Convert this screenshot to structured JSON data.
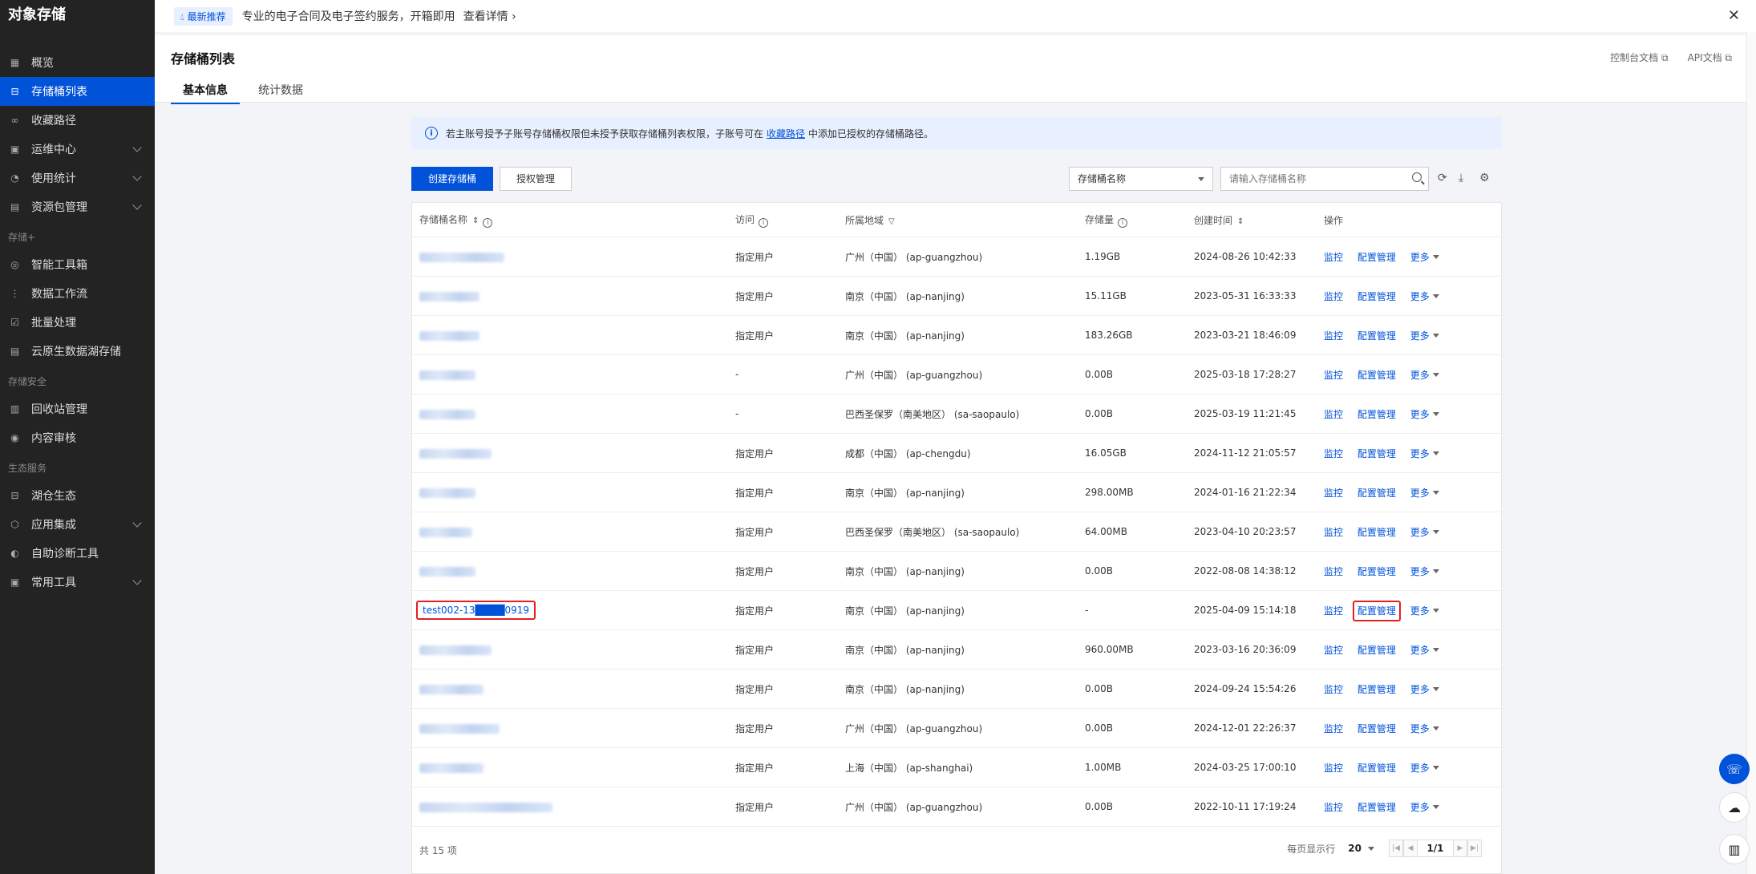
{
  "app": {
    "title": "对象存储"
  },
  "sidebar": {
    "items": [
      {
        "label": "概览",
        "icon": "grid-icon"
      },
      {
        "label": "存储桶列表",
        "icon": "bucket-icon",
        "active": true
      },
      {
        "label": "收藏路径",
        "icon": "link-icon"
      },
      {
        "label": "运维中心",
        "icon": "calendar-icon",
        "expand": true
      },
      {
        "label": "使用统计",
        "icon": "pie-icon",
        "expand": true
      },
      {
        "label": "资源包管理",
        "icon": "package-icon",
        "expand": true
      }
    ],
    "section_storage": "存储+",
    "items2": [
      {
        "label": "智能工具箱",
        "icon": "toolbox-icon"
      },
      {
        "label": "数据工作流",
        "icon": "workflow-icon"
      },
      {
        "label": "批量处理",
        "icon": "batch-icon"
      },
      {
        "label": "云原生数据湖存储",
        "icon": "datalake-icon"
      }
    ],
    "section_security": "存储安全",
    "items3": [
      {
        "label": "回收站管理",
        "icon": "trash-icon"
      },
      {
        "label": "内容审核",
        "icon": "audit-icon"
      }
    ],
    "section_eco": "生态服务",
    "items4": [
      {
        "label": "湖仓生态",
        "icon": "lakehouse-icon"
      },
      {
        "label": "应用集成",
        "icon": "integration-icon",
        "expand": true
      },
      {
        "label": "自助诊断工具",
        "icon": "diagnose-icon"
      },
      {
        "label": "常用工具",
        "icon": "tools-icon",
        "expand": true
      }
    ]
  },
  "banner": {
    "badge": "最新推荐",
    "text": "专业的电子合同及电子签约服务，开箱即用",
    "more": "查看详情"
  },
  "header": {
    "title": "存储桶列表",
    "links": [
      "控制台文档",
      "API文档"
    ],
    "tabs": [
      "基本信息",
      "统计数据"
    ]
  },
  "notice": {
    "pre": "若主账号授予子账号存储桶权限但未授予获取存储桶列表权限，子账号可在",
    "link": "收藏路径",
    "post": "中添加已授权的存储桶路径。"
  },
  "toolbar": {
    "create_label": "创建存储桶",
    "auth_label": "授权管理",
    "filter_selected": "存储桶名称",
    "search_placeholder": "请输入存储桶名称"
  },
  "table": {
    "headers": [
      "存储桶名称",
      "访问",
      "所属地域",
      "存储量",
      "创建时间",
      "操作"
    ],
    "op_labels": {
      "monitor": "监控",
      "config": "配置管理",
      "more": "更多"
    },
    "rows": [
      {
        "name": "",
        "access": "指定用户",
        "region": "广州（中国） (ap-guangzhou)",
        "size": "1.19GB",
        "created": "2024-08-26 10:42:33"
      },
      {
        "name": "",
        "access": "指定用户",
        "region": "南京（中国） (ap-nanjing)",
        "size": "15.11GB",
        "created": "2023-05-31 16:33:33"
      },
      {
        "name": "",
        "access": "指定用户",
        "region": "南京（中国） (ap-nanjing)",
        "size": "183.26GB",
        "created": "2023-03-21 18:46:09"
      },
      {
        "name": "",
        "access": "-",
        "region": "广州（中国） (ap-guangzhou)",
        "size": "0.00B",
        "created": "2025-03-18 17:28:27"
      },
      {
        "name": "",
        "access": "-",
        "region": "巴西圣保罗（南美地区） (sa-saopaulo)",
        "size": "0.00B",
        "created": "2025-03-19 11:21:45"
      },
      {
        "name": "",
        "access": "指定用户",
        "region": "成都（中国） (ap-chengdu)",
        "size": "16.05GB",
        "created": "2024-11-12 21:05:57"
      },
      {
        "name": "",
        "access": "指定用户",
        "region": "南京（中国） (ap-nanjing)",
        "size": "298.00MB",
        "created": "2024-01-16 21:22:34"
      },
      {
        "name": "",
        "access": "指定用户",
        "region": "巴西圣保罗（南美地区） (sa-saopaulo)",
        "size": "64.00MB",
        "created": "2023-04-10 20:23:57"
      },
      {
        "name": "",
        "access": "指定用户",
        "region": "南京（中国） (ap-nanjing)",
        "size": "0.00B",
        "created": "2022-08-08 14:38:12"
      },
      {
        "name": "test002-13████0919",
        "access": "指定用户",
        "region": "南京（中国） (ap-nanjing)",
        "size": "-",
        "created": "2025-04-09 15:14:18",
        "highlight": true
      },
      {
        "name": "",
        "access": "指定用户",
        "region": "南京（中国） (ap-nanjing)",
        "size": "960.00MB",
        "created": "2023-03-16 20:36:09"
      },
      {
        "name": "",
        "access": "指定用户",
        "region": "南京（中国） (ap-nanjing)",
        "size": "0.00B",
        "created": "2024-09-24 15:54:26"
      },
      {
        "name": "",
        "access": "指定用户",
        "region": "广州（中国） (ap-guangzhou)",
        "size": "0.00B",
        "created": "2024-12-01 22:26:37"
      },
      {
        "name": "",
        "access": "指定用户",
        "region": "上海（中国） (ap-shanghai)",
        "size": "1.00MB",
        "created": "2024-03-25 17:00:10"
      },
      {
        "name": "",
        "access": "指定用户",
        "region": "广州（中国） (ap-guangzhou)",
        "size": "0.00B",
        "created": "2022-10-11 17:19:24"
      }
    ]
  },
  "footer": {
    "total": "共 15 项",
    "per_page_label": "每页显示行",
    "per_page_value": "20",
    "page": "1/1"
  }
}
